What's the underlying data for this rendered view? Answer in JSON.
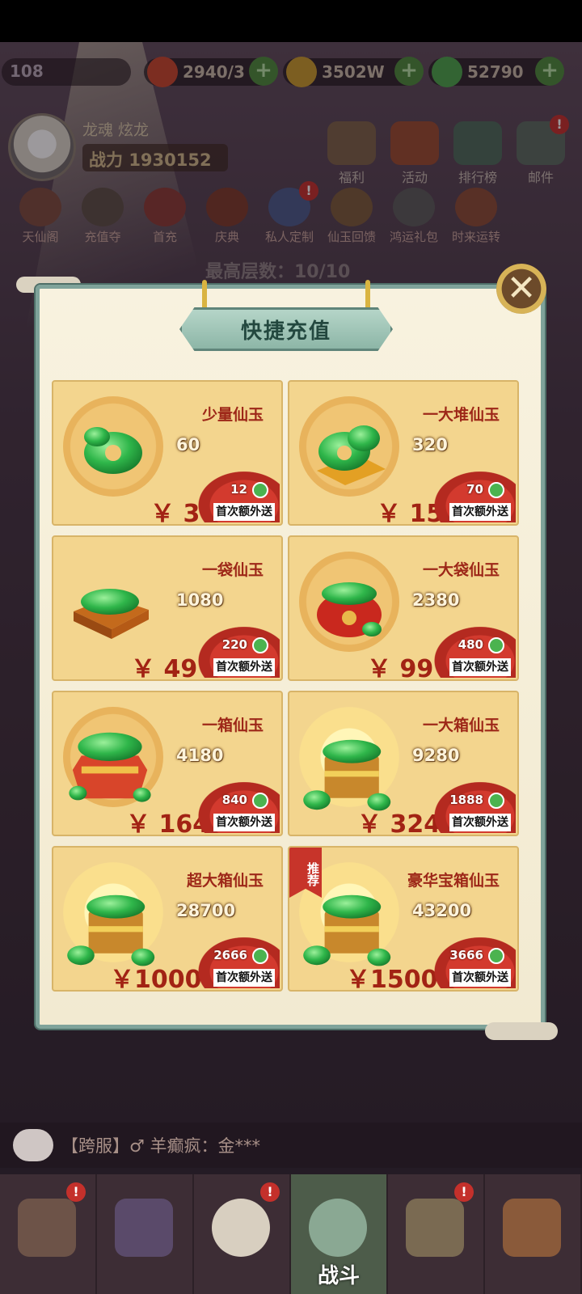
{
  "top_bar": {
    "level": "108",
    "stamina": "2940/3",
    "gold": "3502W",
    "jade": "52790",
    "plus": "+"
  },
  "player": {
    "name": "龙魂  炫龙",
    "power_label": "战力",
    "power_value": "1930152"
  },
  "top_icons": [
    {
      "label": "福利"
    },
    {
      "label": "活动"
    },
    {
      "label": "排行榜"
    },
    {
      "label": "邮件"
    }
  ],
  "row2_icons": [
    {
      "label": "天仙阁"
    },
    {
      "label": "充值夺"
    },
    {
      "label": "首充"
    },
    {
      "label": "庆典"
    },
    {
      "label": "私人定制"
    },
    {
      "label": "仙玉回馈"
    },
    {
      "label": "鸿运礼包"
    },
    {
      "label": "时来运转"
    }
  ],
  "floor_text": "最高层数：10/10",
  "modal": {
    "title": "快捷充值",
    "close_glyph": "✕",
    "recommend_tag": "推荐",
    "extra_label": "首次额外送",
    "currency": "￥",
    "items": [
      {
        "name": "少量仙玉",
        "amount": "60",
        "price": "3",
        "bonus": "12"
      },
      {
        "name": "一大堆仙玉",
        "amount": "320",
        "price": "15",
        "bonus": "70"
      },
      {
        "name": "一袋仙玉",
        "amount": "1080",
        "price": "49",
        "bonus": "220"
      },
      {
        "name": "一大袋仙玉",
        "amount": "2380",
        "price": "99",
        "bonus": "480"
      },
      {
        "name": "一箱仙玉",
        "amount": "4180",
        "price": "164",
        "bonus": "840"
      },
      {
        "name": "一大箱仙玉",
        "amount": "9280",
        "price": "324",
        "bonus": "1888"
      },
      {
        "name": "超大箱仙玉",
        "amount": "28700",
        "price": "1000",
        "bonus": "2666"
      },
      {
        "name": "豪华宝箱仙玉",
        "amount": "43200",
        "price": "1500",
        "bonus": "3666"
      }
    ]
  },
  "chat": {
    "text": "【跨服】♂ 羊癫疯：金***"
  },
  "bottom_nav": {
    "active_label": "战斗"
  },
  "colors": {
    "panel_bg": "#f8f2df",
    "card_bg": "#f3d58e",
    "price_red": "#a22314",
    "panel_border": "#7fa39a",
    "badge_red": "#c4302b"
  }
}
